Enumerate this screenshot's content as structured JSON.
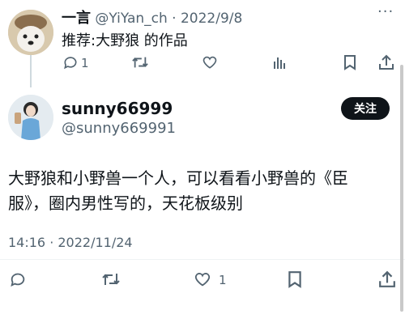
{
  "reply": {
    "display_name": "一言",
    "handle": "@YiYan_ch",
    "separator": "·",
    "date": "2022/9/8",
    "text": "推荐:大野狼 的作品",
    "more_label": "···",
    "reply_count": "1"
  },
  "main": {
    "display_name": "sunny66999",
    "handle": "@sunny669991",
    "follow_label": "关注",
    "text_line1": "大野狼和小野兽一个人，可以看看小野兽的《臣",
    "text_line2": "服》，圈内男性写的，天花板级别",
    "timestamp": "14:16 · 2022/11/24",
    "like_count": "1"
  },
  "icons": {
    "reply": "reply-icon",
    "retweet": "retweet-icon",
    "like": "heart-icon",
    "views": "views-icon",
    "bookmark": "bookmark-icon",
    "share": "share-icon"
  }
}
